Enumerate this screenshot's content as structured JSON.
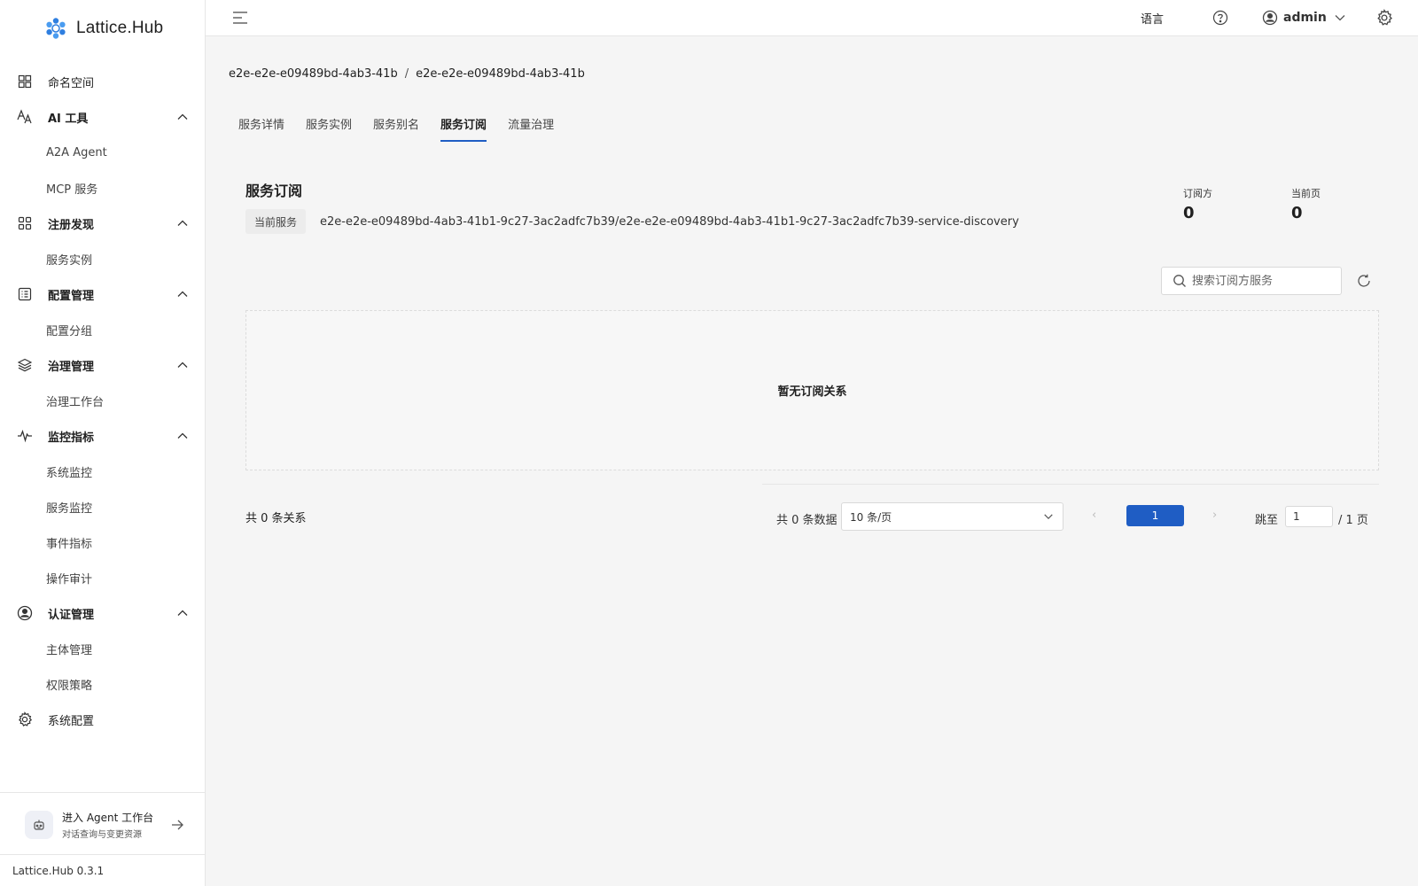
{
  "app": {
    "name": "Lattice.Hub",
    "version": "Lattice.Hub 0.3.1"
  },
  "sidebar": {
    "items": [
      {
        "type": "item",
        "label": "命名空间",
        "icon": "namespace-icon"
      },
      {
        "type": "group",
        "label": "AI 工具",
        "icon": "ai-tools-icon",
        "children": [
          "A2A Agent",
          "MCP 服务"
        ]
      },
      {
        "type": "group",
        "label": "注册发现",
        "icon": "grid-icon",
        "children": [
          "服务实例"
        ]
      },
      {
        "type": "group",
        "label": "配置管理",
        "icon": "list-icon",
        "children": [
          "配置分组"
        ]
      },
      {
        "type": "group",
        "label": "治理管理",
        "icon": "layers-icon",
        "children": [
          "治理工作台"
        ]
      },
      {
        "type": "group",
        "label": "监控指标",
        "icon": "pulse-icon",
        "children": [
          "系统监控",
          "服务监控",
          "事件指标",
          "操作审计"
        ]
      },
      {
        "type": "group",
        "label": "认证管理",
        "icon": "user-circle-icon",
        "children": [
          "主体管理",
          "权限策略"
        ]
      },
      {
        "type": "item",
        "label": "系统配置",
        "icon": "gear-icon"
      }
    ],
    "agent_card": {
      "title": "进入 Agent 工作台",
      "subtitle": "对话查询与变更资源"
    }
  },
  "header": {
    "language": "语言",
    "user": "admin"
  },
  "breadcrumb": [
    "e2e-e2e-e09489bd-4ab3-41b",
    "e2e-e2e-e09489bd-4ab3-41b"
  ],
  "tabs": [
    {
      "label": "服务详情",
      "active": false
    },
    {
      "label": "服务实例",
      "active": false
    },
    {
      "label": "服务别名",
      "active": false
    },
    {
      "label": "服务订阅",
      "active": true
    },
    {
      "label": "流量治理",
      "active": false
    }
  ],
  "subscription": {
    "title": "服务订阅",
    "current_service_tag": "当前服务",
    "current_service": "e2e-e2e-e09489bd-4ab3-41b1-9c27-3ac2adfc7b39/e2e-e2e-e09489bd-4ab3-41b1-9c27-3ac2adfc7b39-service-discovery",
    "stats": [
      {
        "label": "订阅方",
        "value": "0"
      },
      {
        "label": "当前页",
        "value": "0"
      }
    ],
    "search_placeholder": "搜索订阅方服务",
    "empty_text": "暂无订阅关系",
    "total_relations": "共 0 条关系"
  },
  "pagination": {
    "total": "共 0 条数据",
    "page_size": "10 条/页",
    "prev": "‹",
    "current": "1",
    "next": "›",
    "jump_label": "跳至",
    "jump_value": "1",
    "total_pages": "/ 1 页"
  },
  "colors": {
    "accent": "#1f5dc4",
    "background": "#f5f5f5",
    "surface": "#ffffff"
  }
}
